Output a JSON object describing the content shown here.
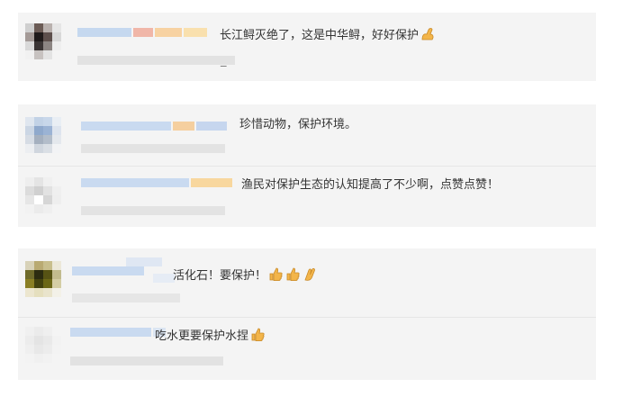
{
  "comments": [
    {
      "text": "长江鲟灭绝了，这是中华鲟，好好保护",
      "emoji": [
        "flexed-biceps"
      ]
    },
    {
      "text": "珍惜动物，保护环境。",
      "emoji": []
    },
    {
      "text": "渔民对保护生态的认知提高了不少啊，点赞点赞！",
      "emoji": []
    },
    {
      "text": "活化石！要保护！",
      "emoji": [
        "thumbs-up",
        "thumbs-up",
        "clapping-hands"
      ]
    },
    {
      "text": "吃水更要保护水捏",
      "emoji": [
        "thumbs-up"
      ]
    }
  ],
  "colors": {
    "card_background": "#f4f4f4",
    "divider": "#e6e6e6",
    "text": "#333333",
    "emoji": "#f3b54a"
  }
}
